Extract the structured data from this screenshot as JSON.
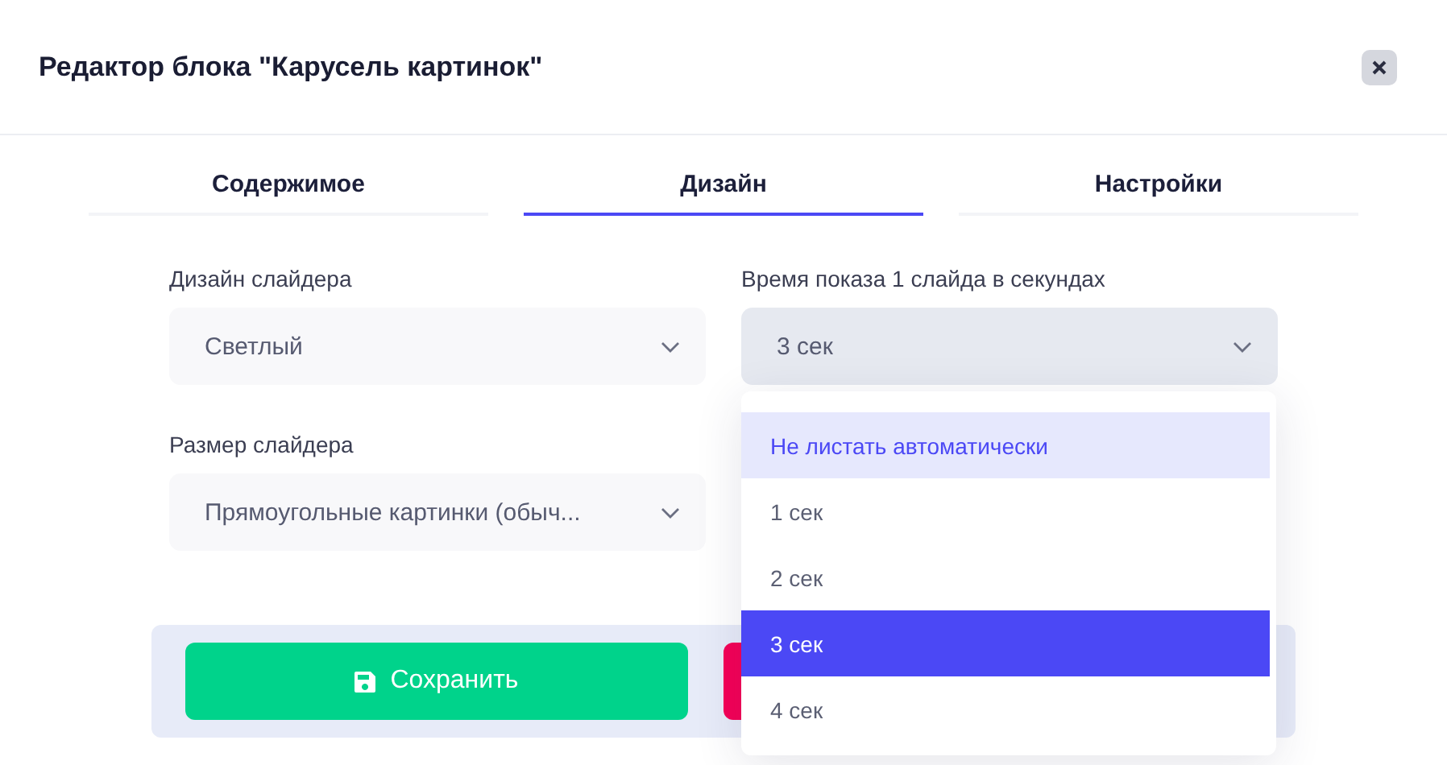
{
  "dialog": {
    "title": "Редактор блока \"Карусель картинок\""
  },
  "tabs": [
    {
      "label": "Содержимое",
      "selected": false
    },
    {
      "label": "Дизайн",
      "selected": true
    },
    {
      "label": "Настройки",
      "selected": false
    }
  ],
  "fields": [
    {
      "label": "Дизайн слайдера",
      "value": "Светлый",
      "open": false
    },
    {
      "label": "Время показа 1 слайда в секундах",
      "value": "3 сек",
      "open": true
    },
    {
      "label": "Размер слайдера",
      "value": "Прямоугольные картинки (обыч...",
      "open": false
    }
  ],
  "dropdown": {
    "options": [
      {
        "label": "Не листать автоматически",
        "selected": false,
        "highlighted": true
      },
      {
        "label": "1 сек",
        "selected": false,
        "highlighted": false
      },
      {
        "label": "2 сек",
        "selected": false,
        "highlighted": false
      },
      {
        "label": "3 сек",
        "selected": true,
        "highlighted": false
      },
      {
        "label": "4 сек",
        "selected": false,
        "highlighted": false
      }
    ]
  },
  "footer": {
    "save_label": "Сохранить"
  }
}
